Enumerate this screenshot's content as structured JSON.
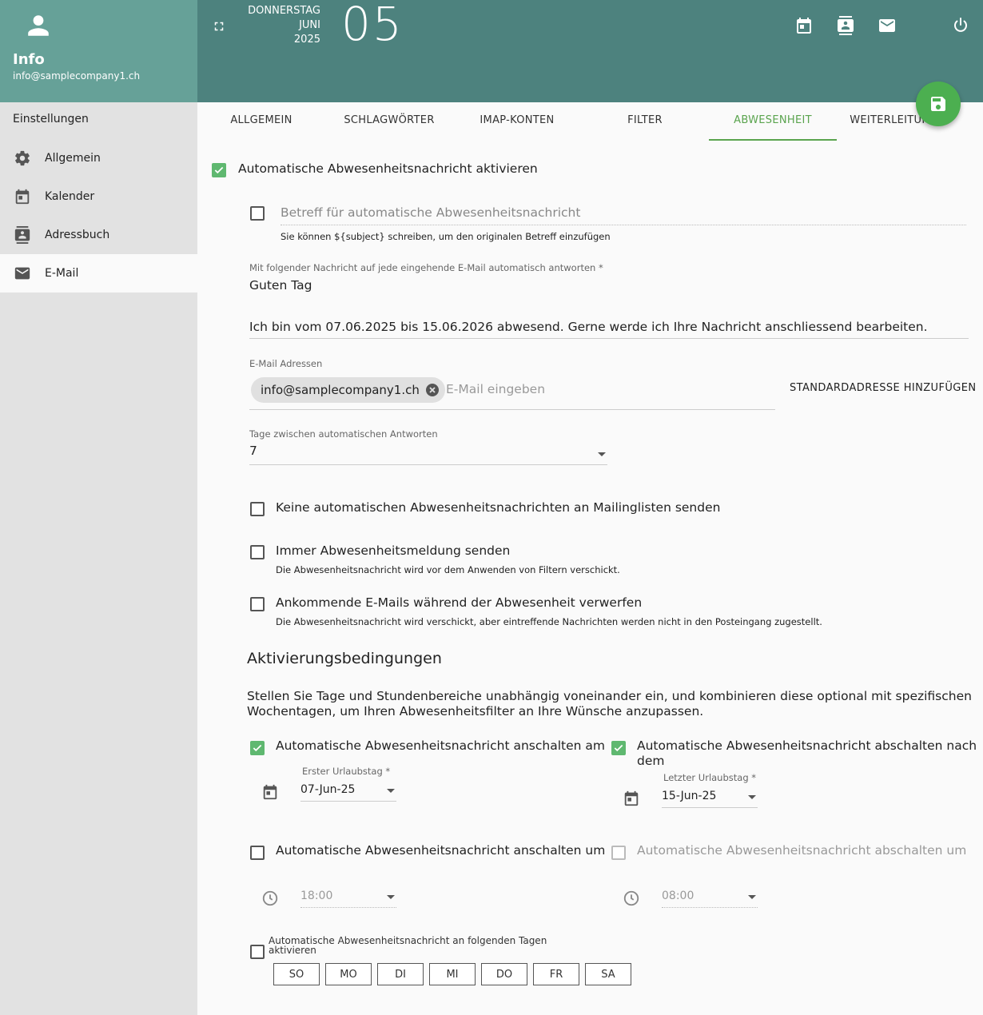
{
  "user": {
    "name": "Info",
    "email": "info@samplecompany1.ch"
  },
  "sidebar": {
    "section": "Einstellungen",
    "items": [
      {
        "label": "Allgemein",
        "icon": "gear-icon"
      },
      {
        "label": "Kalender",
        "icon": "calendar-icon"
      },
      {
        "label": "Adressbuch",
        "icon": "contacts-icon"
      },
      {
        "label": "E-Mail",
        "icon": "mail-icon"
      }
    ]
  },
  "topbar": {
    "weekday": "DONNERSTAG",
    "month": "JUNI",
    "year": "2025",
    "day": "05"
  },
  "tabs": [
    "ALLGEMEIN",
    "SCHLAGWÖRTER",
    "IMAP-KONTEN",
    "FILTER",
    "ABWESENHEIT",
    "WEITERLEITUNG"
  ],
  "form": {
    "activate_label": "Automatische Abwesenheitsnachricht aktivieren",
    "subject_placeholder": "Betreff für automatische Abwesenheitsnachricht",
    "subject_hint": "Sie können ${subject} schreiben, um den originalen Betreff einzufügen",
    "message_label": "Mit folgender Nachricht auf jede eingehende E-Mail automatisch antworten",
    "message_line1": "Guten Tag",
    "message_line2": "Ich bin vom 07.06.2025 bis 15.06.2026 abwesend. Gerne werde ich Ihre Nachricht anschliessend bearbeiten.",
    "email_label": "E-Mail Adressen",
    "email_chip": "info@samplecompany1.ch",
    "email_placeholder": "E-Mail eingeben",
    "add_default_button": "STANDARDADRESSE HINZUFÜGEN",
    "days_label": "Tage zwischen automatischen Antworten",
    "days_value": "7",
    "no_mailinglist_label": "Keine automatischen Abwesenheitsnachrichten an Mailinglisten senden",
    "always_send_label": "Immer Abwesenheitsmeldung senden",
    "always_send_hint": "Die Abwesenheitsnachricht wird vor dem Anwenden von Filtern verschickt.",
    "discard_label": "Ankommende E-Mails während der Abwesenheit verwerfen",
    "discard_hint": "Die Abwesenheitsnachricht wird verschickt, aber eintreffende Nachrichten werden nicht in den Posteingang zugestellt.",
    "activation_title": "Aktivierungsbedingungen",
    "activation_desc_line1": "Stellen Sie Tage und Stundenbereiche unabhängig voneinander ein, und kombinieren diese optional mit spezifischen",
    "activation_desc_line2": "Wochentagen, um Ihren Abwesenheitsfilter an Ihre Wünsche anzupassen.",
    "enable_on_label": "Automatische Abwesenheitsnachricht anschalten am",
    "disable_after_label_1": "Automatische Abwesenheitsnachricht abschalten nach",
    "disable_after_label_2": "dem",
    "first_day_label": "Erster Urlaubstag",
    "first_day_value": "07-Jun-25",
    "last_day_label": "Letzter Urlaubstag",
    "last_day_value": "15-Jun-25",
    "enable_time_label": "Automatische Abwesenheitsnachricht anschalten um",
    "disable_time_label": "Automatische Abwesenheitsnachricht abschalten um",
    "enable_time_value": "18:00",
    "disable_time_value": "08:00",
    "weekdays_label_1": "Automatische Abwesenheitsnachricht an folgenden Tagen",
    "weekdays_label_2": "aktivieren",
    "weekdays": [
      "SO",
      "MO",
      "DI",
      "MI",
      "DO",
      "FR",
      "SA"
    ]
  },
  "colors": {
    "accent": "#5aa44e",
    "header_sidebar": "#66a198",
    "header_top": "#4d827e",
    "fab": "#4caf50"
  }
}
